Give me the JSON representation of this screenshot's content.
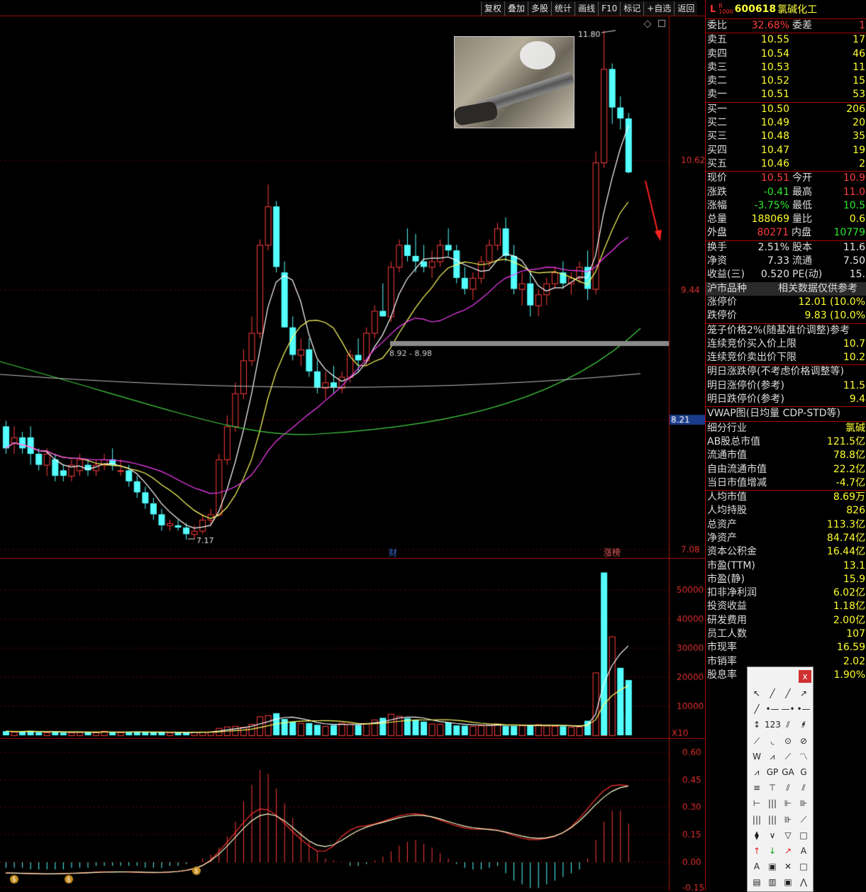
{
  "toolbar": [
    "复权",
    "叠加",
    "多股",
    "统计",
    "画线",
    "F10",
    "标记",
    "+自选",
    "返回"
  ],
  "stock": {
    "badge": "L",
    "badge_top": "R",
    "badge_bottom": "1000",
    "code": "600618",
    "name": "氯碱化工"
  },
  "chart": {
    "price_labels": [
      "10.62",
      "9.44",
      "8.21",
      "7.08"
    ],
    "vol_labels": [
      "50000",
      "40000",
      "30000",
      "20000",
      "10000"
    ],
    "vol_unit": "X10",
    "macd_labels": [
      "0.60",
      "0.45",
      "0.30",
      "0.15",
      "0.00",
      "-0.15"
    ],
    "high_label": "11.80",
    "low_label": "7.17",
    "zone_label": "8.92 - 8.98",
    "marker_cai": "财",
    "marker_zhangbang": "涨榜"
  },
  "quote": {
    "weibi_label": "委比",
    "weibi_value": "32.68%",
    "weicha_label": "委差",
    "weicha_value": "1",
    "asks": [
      {
        "label": "卖五",
        "price": "10.55",
        "vol": "17"
      },
      {
        "label": "卖四",
        "price": "10.54",
        "vol": "46"
      },
      {
        "label": "卖三",
        "price": "10.53",
        "vol": "11"
      },
      {
        "label": "卖二",
        "price": "10.52",
        "vol": "15"
      },
      {
        "label": "卖一",
        "price": "10.51",
        "vol": "53"
      }
    ],
    "bids": [
      {
        "label": "买一",
        "price": "10.50",
        "vol": "206"
      },
      {
        "label": "买二",
        "price": "10.49",
        "vol": "20"
      },
      {
        "label": "买三",
        "price": "10.48",
        "vol": "35"
      },
      {
        "label": "买四",
        "price": "10.47",
        "vol": "19"
      },
      {
        "label": "买五",
        "price": "10.46",
        "vol": "2"
      }
    ],
    "stats": [
      {
        "l1": "现价",
        "v1": "10.51",
        "c1": "red",
        "l2": "今开",
        "v2": "10.9",
        "c2": "red"
      },
      {
        "l1": "涨跌",
        "v1": "-0.41",
        "c1": "grn",
        "l2": "最高",
        "v2": "11.0",
        "c2": "red"
      },
      {
        "l1": "涨幅",
        "v1": "-3.75%",
        "c1": "grn",
        "l2": "最低",
        "v2": "10.5",
        "c2": "grn"
      },
      {
        "l1": "总量",
        "v1": "188069",
        "c1": "yel",
        "l2": "量比",
        "v2": "0.6",
        "c2": "yel"
      },
      {
        "l1": "外盘",
        "v1": "80271",
        "c1": "red",
        "l2": "内盘",
        "v2": "10779",
        "c2": "grn"
      }
    ],
    "stats2": [
      {
        "l1": "换手",
        "v1": "2.51%",
        "l2": "股本",
        "v2": "11.6"
      },
      {
        "l1": "净资",
        "v1": "7.33",
        "l2": "流通",
        "v2": "7.50"
      },
      {
        "l1": "收益(三)",
        "v1": "0.520",
        "l2": "PE(动)",
        "v2": "15."
      }
    ]
  },
  "market": {
    "label": "沪市品种",
    "note": "相关数据仅供参考"
  },
  "limits": [
    {
      "k": "涨停价",
      "v": "12.01 (10.0%",
      "c": "red"
    },
    {
      "k": "跌停价",
      "v": "9.83 (10.0%",
      "c": "yel"
    }
  ],
  "cage": {
    "title": "笼子价格2%(随基准价调整)参考",
    "rows": [
      {
        "k": "连续竞价买入价上限",
        "v": "10.7"
      },
      {
        "k": "连续竞价卖出价下限",
        "v": "10.2"
      }
    ]
  },
  "tomorrow": {
    "title": "明日涨跌停(不考虑价格调整等)",
    "rows": [
      {
        "k": "明日涨停价(参考)",
        "v": "11.5"
      },
      {
        "k": "明日跌停价(参考)",
        "v": "9.4"
      }
    ]
  },
  "vwap": "VWAP图(日均量 CDP-STD等)",
  "fundamentals": [
    {
      "k": "细分行业",
      "v": "氯碱"
    },
    {
      "k": "AB股总市值",
      "v": "121.5亿"
    },
    {
      "k": "流通市值",
      "v": "78.8亿"
    },
    {
      "k": "自由流通市值",
      "v": "22.2亿"
    },
    {
      "k": "当日市值增减",
      "v": "-4.7亿"
    }
  ],
  "fundamentals2": [
    {
      "k": "人均市值",
      "v": "8.69万"
    },
    {
      "k": "人均持股",
      "v": "826"
    },
    {
      "k": "总资产",
      "v": "113.3亿"
    },
    {
      "k": "净资产",
      "v": "84.74亿"
    },
    {
      "k": "资本公积金",
      "v": "16.44亿"
    },
    {
      "k": "市盈(TTM)",
      "v": "13.1"
    },
    {
      "k": "市盈(静)",
      "v": "15.9"
    },
    {
      "k": "扣非净利润",
      "v": "6.02亿"
    },
    {
      "k": "投资收益",
      "v": "1.18亿"
    },
    {
      "k": "研发费用",
      "v": "2.00亿"
    },
    {
      "k": "员工人数",
      "v": "107"
    },
    {
      "k": "市现率",
      "v": "16.59"
    },
    {
      "k": "市销率",
      "v": "2.02"
    },
    {
      "k": "股息率",
      "v": "1.90%"
    }
  ],
  "draw_tools": [
    "↖",
    "╱",
    "╱",
    "↗",
    "╱",
    "•—",
    "—•",
    "•—•",
    "↕",
    "123",
    "⫽",
    "⫽",
    "⟋",
    "◟",
    "⊙",
    "⊘",
    "W",
    "⩘",
    "⟋",
    "〽",
    "⩘",
    "GP",
    "GA",
    "G",
    "≡",
    "⊤",
    "⫽",
    "⫽",
    "⊢",
    "|||",
    "⊩",
    "⊪",
    "|||",
    "|||",
    "⊪",
    "⟋",
    "⧫",
    "∨",
    "▽",
    "□",
    "↑",
    "↓",
    "↗",
    "A",
    "A",
    "▣",
    "✕",
    "□",
    "▤",
    "▥",
    "▣",
    "⋀"
  ],
  "close_label": "x"
}
